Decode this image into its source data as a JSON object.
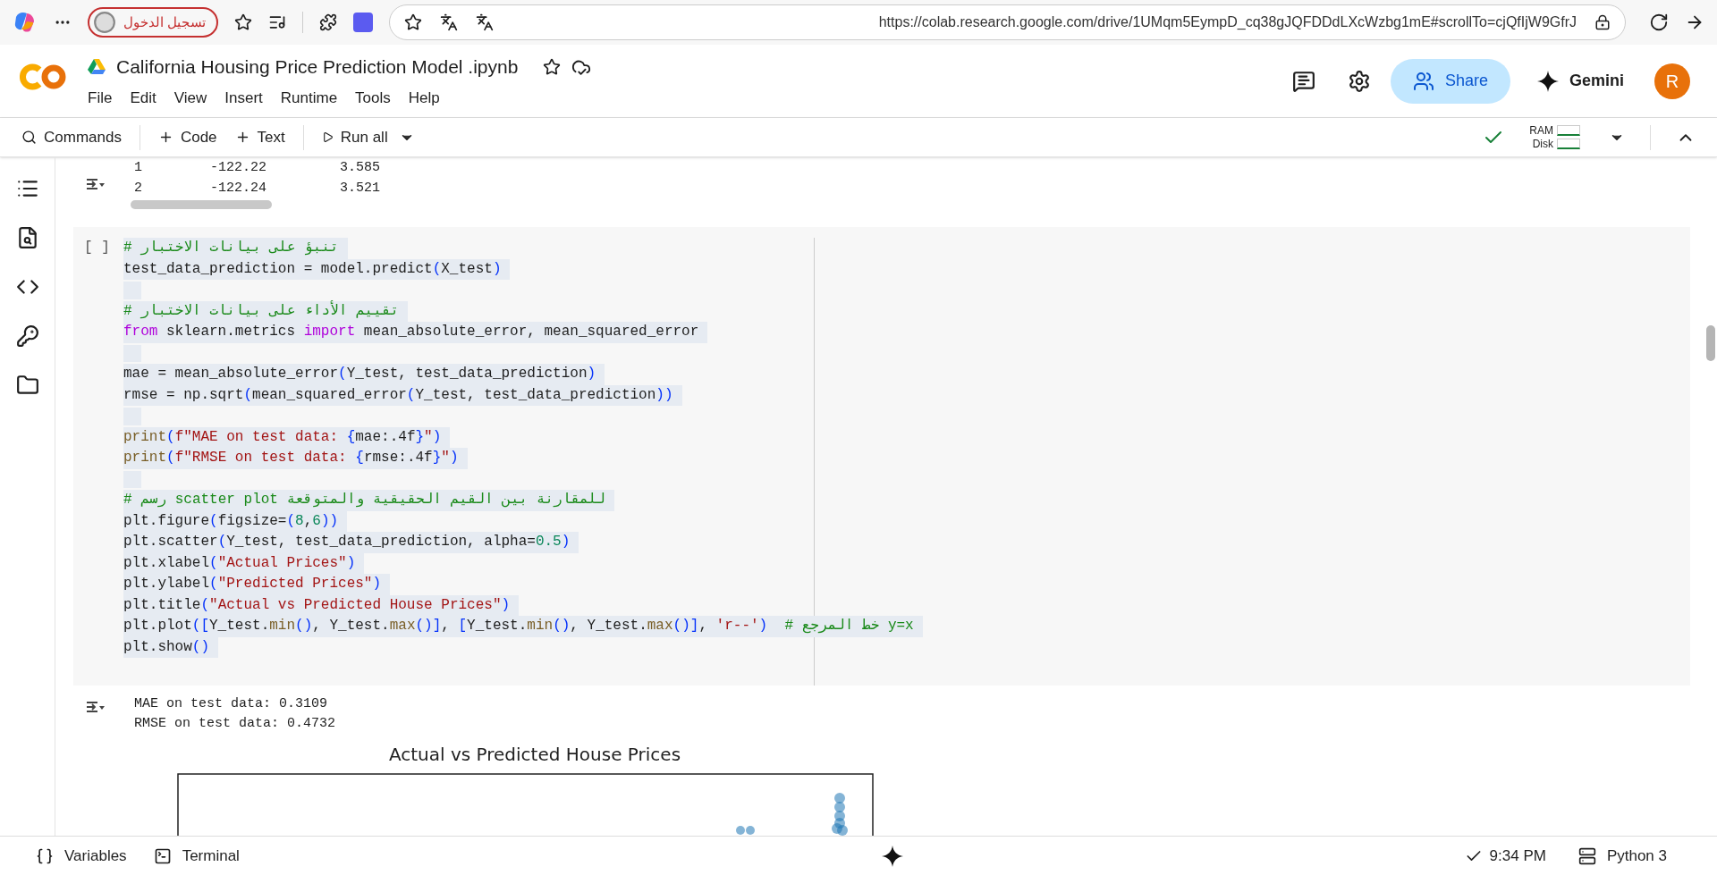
{
  "browser": {
    "profile_button": "تسجيل الدخول",
    "address": "https://colab.research.google.com/drive/1UMqm5EympD_cq38gJQFDDdLXcWzbg1mE#scrollTo=cjQfIjW9GfrJ"
  },
  "notebook": {
    "title": "California Housing Price Prediction Model .ipynb",
    "menu": [
      "File",
      "Edit",
      "View",
      "Insert",
      "Runtime",
      "Tools",
      "Help"
    ],
    "share": "Share",
    "gemini": "Gemini",
    "avatar": "R"
  },
  "toolbar": {
    "commands": "Commands",
    "add_code": "Code",
    "add_text": "Text",
    "run_all": "Run all",
    "ram": "RAM",
    "disk": "Disk"
  },
  "output_table": {
    "rows": [
      [
        "1",
        "-122.22",
        "3.585"
      ],
      [
        "2",
        "-122.24",
        "3.521"
      ]
    ]
  },
  "code_cell": {
    "prompt": "[ ]",
    "lines": [
      {
        "kind": "code",
        "tokens": [
          {
            "text": "# تنبؤ على بيانات الاختبار",
            "kind": "comment"
          }
        ]
      },
      {
        "kind": "code",
        "tokens": [
          {
            "text": "test_data_prediction = model.predict",
            "kind": "plain"
          },
          {
            "text": "(",
            "kind": "bracket"
          },
          {
            "text": "X_test",
            "kind": "plain"
          },
          {
            "text": ")",
            "kind": "bracket"
          }
        ]
      },
      {
        "kind": "blank"
      },
      {
        "kind": "code",
        "tokens": [
          {
            "text": "# تقييم الأداء على بيانات الاختبار",
            "kind": "comment"
          }
        ]
      },
      {
        "kind": "code",
        "tokens": [
          {
            "text": "from",
            "kind": "keyword"
          },
          {
            "text": " sklearn.metrics ",
            "kind": "plain"
          },
          {
            "text": "import",
            "kind": "keyword"
          },
          {
            "text": " mean_absolute_error, mean_squared_error",
            "kind": "plain"
          }
        ]
      },
      {
        "kind": "blank"
      },
      {
        "kind": "code",
        "tokens": [
          {
            "text": "mae = mean_absolute_error",
            "kind": "plain"
          },
          {
            "text": "(",
            "kind": "bracket"
          },
          {
            "text": "Y_test, test_data_prediction",
            "kind": "plain"
          },
          {
            "text": ")",
            "kind": "bracket"
          }
        ]
      },
      {
        "kind": "code",
        "tokens": [
          {
            "text": "rmse = np.sqrt",
            "kind": "plain"
          },
          {
            "text": "(",
            "kind": "bracket"
          },
          {
            "text": "mean_squared_error",
            "kind": "plain"
          },
          {
            "text": "(",
            "kind": "bracket"
          },
          {
            "text": "Y_test, test_data_prediction",
            "kind": "plain"
          },
          {
            "text": "))",
            "kind": "bracket"
          }
        ]
      },
      {
        "kind": "blank"
      },
      {
        "kind": "code",
        "tokens": [
          {
            "text": "print",
            "kind": "call"
          },
          {
            "text": "(",
            "kind": "bracket"
          },
          {
            "text": "f\"MAE on test data: ",
            "kind": "string"
          },
          {
            "text": "{",
            "kind": "bracket"
          },
          {
            "text": "mae:.4f",
            "kind": "plain"
          },
          {
            "text": "}",
            "kind": "bracket"
          },
          {
            "text": "\"",
            "kind": "string"
          },
          {
            "text": ")",
            "kind": "bracket"
          }
        ]
      },
      {
        "kind": "code",
        "tokens": [
          {
            "text": "print",
            "kind": "call"
          },
          {
            "text": "(",
            "kind": "bracket"
          },
          {
            "text": "f\"RMSE on test data: ",
            "kind": "string"
          },
          {
            "text": "{",
            "kind": "bracket"
          },
          {
            "text": "rmse:.4f",
            "kind": "plain"
          },
          {
            "text": "}",
            "kind": "bracket"
          },
          {
            "text": "\"",
            "kind": "string"
          },
          {
            "text": ")",
            "kind": "bracket"
          }
        ]
      },
      {
        "kind": "blank"
      },
      {
        "kind": "code",
        "tokens": [
          {
            "text": "# رسم scatter plot للمقارنة بين القيم الحقيقية والمتوقعة",
            "kind": "comment"
          }
        ]
      },
      {
        "kind": "code",
        "tokens": [
          {
            "text": "plt.figure",
            "kind": "plain"
          },
          {
            "text": "(",
            "kind": "bracket"
          },
          {
            "text": "figsize=",
            "kind": "plain"
          },
          {
            "text": "(",
            "kind": "bracket"
          },
          {
            "text": "8",
            "kind": "number"
          },
          {
            "text": ",",
            "kind": "plain"
          },
          {
            "text": "6",
            "kind": "number"
          },
          {
            "text": "))",
            "kind": "bracket"
          }
        ]
      },
      {
        "kind": "code",
        "tokens": [
          {
            "text": "plt.scatter",
            "kind": "plain"
          },
          {
            "text": "(",
            "kind": "bracket"
          },
          {
            "text": "Y_test, test_data_prediction, alpha=",
            "kind": "plain"
          },
          {
            "text": "0.5",
            "kind": "number"
          },
          {
            "text": ")",
            "kind": "bracket"
          }
        ]
      },
      {
        "kind": "code",
        "tokens": [
          {
            "text": "plt.xlabel",
            "kind": "plain"
          },
          {
            "text": "(",
            "kind": "bracket"
          },
          {
            "text": "\"Actual Prices\"",
            "kind": "string"
          },
          {
            "text": ")",
            "kind": "bracket"
          }
        ]
      },
      {
        "kind": "code",
        "tokens": [
          {
            "text": "plt.ylabel",
            "kind": "plain"
          },
          {
            "text": "(",
            "kind": "bracket"
          },
          {
            "text": "\"Predicted Prices\"",
            "kind": "string"
          },
          {
            "text": ")",
            "kind": "bracket"
          }
        ]
      },
      {
        "kind": "code",
        "tokens": [
          {
            "text": "plt.title",
            "kind": "plain"
          },
          {
            "text": "(",
            "kind": "bracket"
          },
          {
            "text": "\"Actual vs Predicted House Prices\"",
            "kind": "string"
          },
          {
            "text": ")",
            "kind": "bracket"
          }
        ]
      },
      {
        "kind": "code",
        "tokens": [
          {
            "text": "plt.plot",
            "kind": "plain"
          },
          {
            "text": "([",
            "kind": "bracket"
          },
          {
            "text": "Y_test.",
            "kind": "plain"
          },
          {
            "text": "min",
            "kind": "call"
          },
          {
            "text": "()",
            "kind": "bracket"
          },
          {
            "text": ", Y_test.",
            "kind": "plain"
          },
          {
            "text": "max",
            "kind": "call"
          },
          {
            "text": "()]",
            "kind": "bracket"
          },
          {
            "text": ", ",
            "kind": "plain"
          },
          {
            "text": "[",
            "kind": "bracket"
          },
          {
            "text": "Y_test.",
            "kind": "plain"
          },
          {
            "text": "min",
            "kind": "call"
          },
          {
            "text": "()",
            "kind": "bracket"
          },
          {
            "text": ", Y_test.",
            "kind": "plain"
          },
          {
            "text": "max",
            "kind": "call"
          },
          {
            "text": "()]",
            "kind": "bracket"
          },
          {
            "text": ", ",
            "kind": "plain"
          },
          {
            "text": "'r--'",
            "kind": "string"
          },
          {
            "text": ")  ",
            "kind": "bracket"
          },
          {
            "text": "# خط المرجع y=x",
            "kind": "comment"
          }
        ]
      },
      {
        "kind": "code",
        "tokens": [
          {
            "text": "plt.show",
            "kind": "plain"
          },
          {
            "text": "()",
            "kind": "bracket"
          }
        ]
      }
    ]
  },
  "cell_output": {
    "lines": [
      "MAE on test data: 0.3109",
      "RMSE on test data: 0.4732"
    ],
    "plot_title": "Actual vs Predicted House Prices"
  },
  "status_bar": {
    "variables": "Variables",
    "terminal": "Terminal",
    "saved_time": "9:34 PM",
    "runtime": "Python 3"
  }
}
